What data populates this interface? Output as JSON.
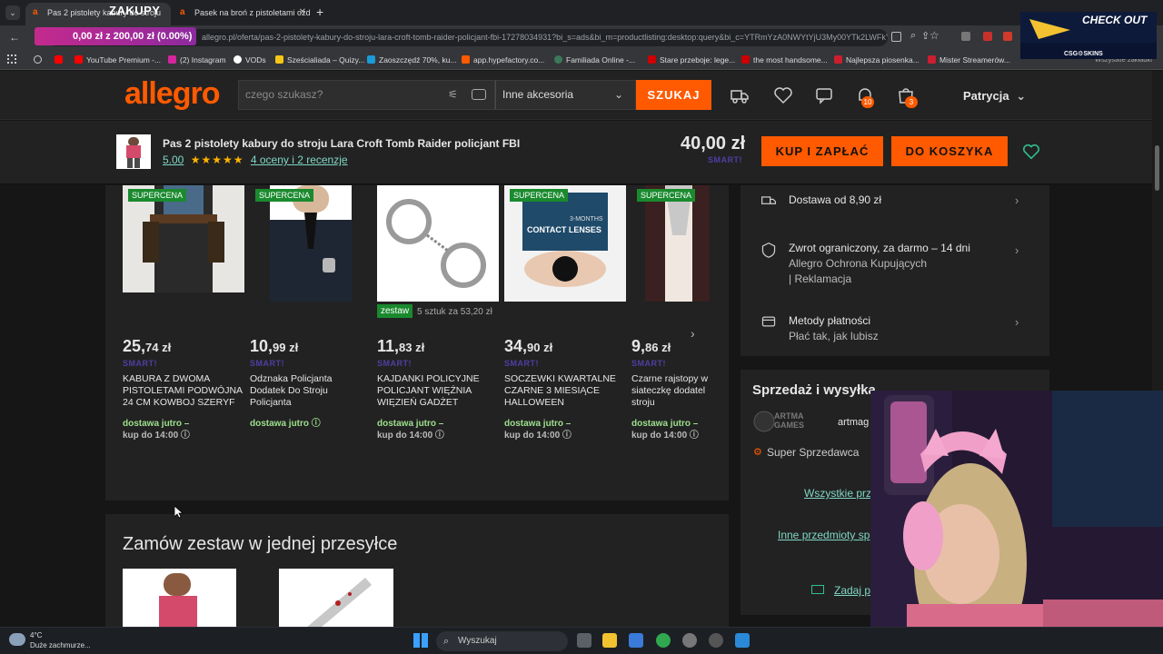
{
  "browser": {
    "tabs": [
      {
        "title": "Pas 2 pistolety kabury do stroju",
        "active": true
      },
      {
        "title": "Pasek na broń z pistoletami ozd",
        "active": false
      }
    ],
    "new_tab": "+",
    "url": "allegro.pl/oferta/pas-2-pistolety-kabury-do-stroju-lara-croft-tomb-raider-policjant-fbi-17278034931?bi_s=ads&bi_m=productlisting:desktop:query&bi_c=YTRmYzA0NWYtYjU3My00YTk2LWFkY2ItMjE2Zm...",
    "bookmarks": [
      {
        "label": "",
        "color": "#ff0000"
      },
      {
        "label": "YouTube Premium -...",
        "color": "#ff0000"
      },
      {
        "label": "(2) Instagram",
        "color": "#d6249f"
      },
      {
        "label": "VODs",
        "color": "#ffffff"
      },
      {
        "label": "Sześcialiada – Quizy...",
        "color": "#f5c518"
      },
      {
        "label": "Zaoszczędź 70%, ku...",
        "color": "#1b9bd7"
      },
      {
        "label": "app.hypefactory.co...",
        "color": "#ff5a00"
      },
      {
        "label": "Familiada Online -...",
        "color": "#3a7a5a"
      },
      {
        "label": "Stare przeboje: lege...",
        "color": "#cc0000"
      },
      {
        "label": "the most handsome...",
        "color": "#cc0000"
      },
      {
        "label": "Najlepsza piosenka...",
        "color": "#cc1e2e"
      },
      {
        "label": "Mister Streamerów...",
        "color": "#cc1e2e"
      }
    ],
    "all_bookmarks": "Wszystkie zakładki"
  },
  "overlay": {
    "title": "ZAKUPY",
    "progress": "0,00 zł z 200,00 zł (0.00%)",
    "progress_fraction": 0.0,
    "promo_title": "CHECK OUT",
    "promo_brand": "CSG⚙SKINS"
  },
  "header": {
    "logo": "allegro",
    "search_placeholder": "czego szukasz?",
    "category": "Inne akcesoria",
    "search_button": "SZUKAJ",
    "notifications_count": "10",
    "cart_count": "3",
    "user": "Patrycja"
  },
  "product_bar": {
    "title": "Pas 2 pistolety kabury do stroju Lara Croft Tomb Raider policjant FBI",
    "rating_value": "5.00",
    "stars": "★★★★★",
    "reviews": "4 oceny i 2 recenzje",
    "price": "40,00 zł",
    "smart": "SMART!",
    "buy_button": "KUP I ZAPŁAĆ",
    "cart_button": "DO KOSZYKA"
  },
  "carousel": {
    "badge": "SUPERCENA",
    "set_tag": "zestaw",
    "set_text": "5 sztuk za 53,20 zł",
    "products": [
      {
        "price_main": "25,",
        "price_cents": "74 zł",
        "smart": "SMART!",
        "name": "KABURA Z DWOMA PISTOLETAMI PODWÓJNA 24 CM KOWBOJ SZERYF",
        "delivery": "dostawa jutro –",
        "delivery2": "kup do 14:00 ⓘ",
        "supercena": true
      },
      {
        "price_main": "10,",
        "price_cents": "99 zł",
        "smart": "SMART!",
        "name": "Odznaka Policjanta Dodatek Do Stroju Policjanta",
        "delivery": "dostawa jutro ⓘ",
        "delivery2": "",
        "supercena": true
      },
      {
        "price_main": "11,",
        "price_cents": "83 zł",
        "smart": "SMART!",
        "name": "KAJDANKI POLICYJNE POLICJANT WIĘŹNIA WIĘZIEŃ GADŻET",
        "delivery": "dostawa jutro –",
        "delivery2": "kup do 14:00 ⓘ",
        "supercena": false
      },
      {
        "price_main": "34,",
        "price_cents": "90 zł",
        "smart": "SMART!",
        "name": "SOCZEWKI KWARTALNE CZARNE 3 MIESIĄCE HALLOWEEN",
        "delivery": "dostawa jutro –",
        "delivery2": "kup do 14:00 ⓘ",
        "supercena": true,
        "img_text1": "3-MONTHS",
        "img_text2": "CONTACT LENSES"
      },
      {
        "price_main": "9,",
        "price_cents": "86 zł",
        "smart": "SMART!",
        "name": "Czarne rajstopy w siateczkę dodatel stroju",
        "delivery": "dostawa jutro –",
        "delivery2": "kup do 14:00 ⓘ",
        "supercena": true
      }
    ]
  },
  "bundle": {
    "title": "Zamów zestaw w jednej przesyłce"
  },
  "info": {
    "delivery": "Dostawa od 8,90 zł",
    "returns": "Zwrot ograniczony, za darmo – 14 dni",
    "returns_sub1": "Allegro Ochrona Kupujących",
    "returns_sub2": "| Reklamacja",
    "payments": "Metody płatności",
    "payments_sub": "Płać tak, jak lubisz"
  },
  "seller": {
    "section_title": "Sprzedaż i wysyłka",
    "name": "artmag",
    "logo_text": "ARTMA GAMES",
    "badge": "Super Sprzedawca",
    "link_all": "Wszystkie prz",
    "link_other": "Inne przedmioty sp",
    "link_ask": "Zadaj p"
  },
  "taskbar": {
    "temp": "4°C",
    "weather": "Duże zachmurze...",
    "search": "Wyszukaj"
  },
  "colors": {
    "accent": "#ff5a00",
    "link": "#7fd7c4",
    "supercena": "#1a8a2e",
    "smart": "#4e3fa3"
  }
}
